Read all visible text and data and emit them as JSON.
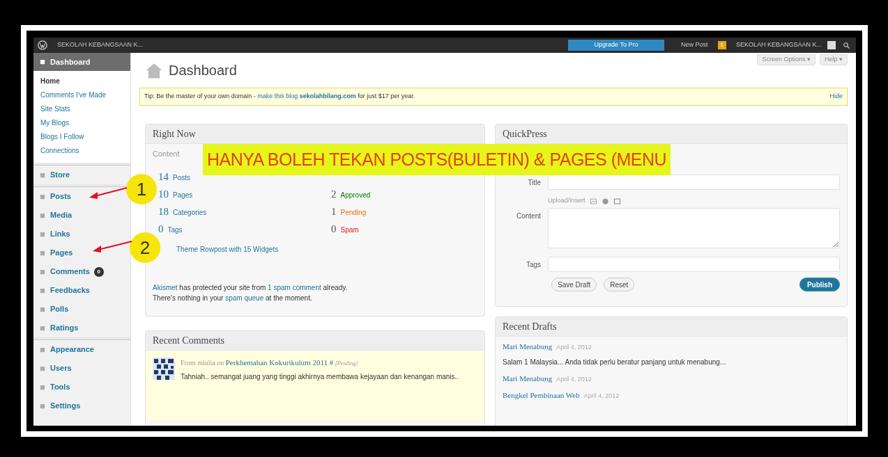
{
  "admin_bar": {
    "site_name": "SEKOLAH KEBANGSAAN K...",
    "upgrade_button": "Upgrade To Pro",
    "new_post": "New Post",
    "notification_count": "1",
    "account_name": "SEKOLAH KEBANGSAAN K..."
  },
  "sidebar": {
    "items": [
      {
        "label": "Dashboard",
        "selected": true,
        "children": [
          {
            "label": "Home",
            "selected": true
          },
          {
            "label": "Comments I've Made",
            "selected": false
          },
          {
            "label": "Site Stats",
            "selected": false
          },
          {
            "label": "My Blogs",
            "selected": false
          },
          {
            "label": "Blogs I Follow",
            "selected": false
          },
          {
            "label": "Connections",
            "selected": false
          }
        ]
      },
      {
        "label": "Store",
        "selected": false,
        "group_start": true
      },
      {
        "label": "Posts",
        "selected": false,
        "group_start": true
      },
      {
        "label": "Media",
        "selected": false
      },
      {
        "label": "Links",
        "selected": false
      },
      {
        "label": "Pages",
        "selected": false
      },
      {
        "label": "Comments",
        "selected": false,
        "badge": "0"
      },
      {
        "label": "Feedbacks",
        "selected": false
      },
      {
        "label": "Polls",
        "selected": false
      },
      {
        "label": "Ratings",
        "selected": false
      },
      {
        "label": "Appearance",
        "selected": false,
        "group_start": true
      },
      {
        "label": "Users",
        "selected": false
      },
      {
        "label": "Tools",
        "selected": false
      },
      {
        "label": "Settings",
        "selected": false
      }
    ]
  },
  "page": {
    "title": "Dashboard",
    "screen_options": "Screen Options ▾",
    "help": "Help ▾"
  },
  "tip": {
    "text": "Tip: Be the master of your own domain - ",
    "link": "make this blog",
    "domain": "sekolahbilang.com",
    "rest": " for just $17 per year.",
    "hide": "Hide"
  },
  "right_now": {
    "title": "Right Now",
    "content_heading": "Content",
    "content": [
      {
        "count": "14",
        "label": "Posts"
      },
      {
        "count": "10",
        "label": "Pages"
      },
      {
        "count": "18",
        "label": "Categories"
      },
      {
        "count": "0",
        "label": "Tags"
      }
    ],
    "discussion": [
      {
        "count": "2",
        "label": "Approved",
        "kind": "approved"
      },
      {
        "count": "1",
        "label": "Pending",
        "kind": "pending"
      },
      {
        "count": "0",
        "label": "Spam",
        "kind": "spam"
      }
    ],
    "theme": "Theme Rowpost with 15 Widgets",
    "akismet": [
      {
        "kind": "link",
        "text": "Akismet"
      },
      {
        "kind": "text",
        "text": " has protected your site from "
      },
      {
        "kind": "link",
        "text": "1 spam comment"
      },
      {
        "kind": "text",
        "text": " already."
      }
    ],
    "akismet_2": [
      {
        "kind": "text",
        "text": "There's nothing in your "
      },
      {
        "kind": "link",
        "text": "spam queue"
      },
      {
        "kind": "text",
        "text": " at the moment."
      }
    ]
  },
  "recent_comments": {
    "title": "Recent Comments",
    "comments": [
      {
        "author": "From miulia on ",
        "post": "Perkhemahan Kokurikulum 2011 #",
        "status": "[Pending]",
        "text": "Tahniah.. semangat juang yang tinggi akhirnya membawa kejayaan dan kenangan manis.."
      }
    ]
  },
  "quickpress": {
    "title": "QuickPress",
    "title_label": "Title",
    "upload_label": "Upload/Insert",
    "content_label": "Content",
    "tags_label": "Tags",
    "save_draft": "Save Draft",
    "reset": "Reset",
    "publish": "Publish"
  },
  "recent_drafts": {
    "title": "Recent Drafts",
    "drafts": [
      {
        "title": "Mari Menabung",
        "date": "April 4, 2012",
        "excerpt": "Salam 1 Malaysia... Anda tidak perlu beratur panjang untuk menabung..."
      },
      {
        "title": "Mari Menabung",
        "date": "April 4, 2012"
      },
      {
        "title": "Bengkel Pembinaan Web",
        "date": "April 4, 2012"
      }
    ]
  },
  "annotation": {
    "banner": "HANYA BOLEH TEKAN POSTS(BULETIN) & PAGES (MENU",
    "callouts": [
      "1",
      "2"
    ]
  }
}
